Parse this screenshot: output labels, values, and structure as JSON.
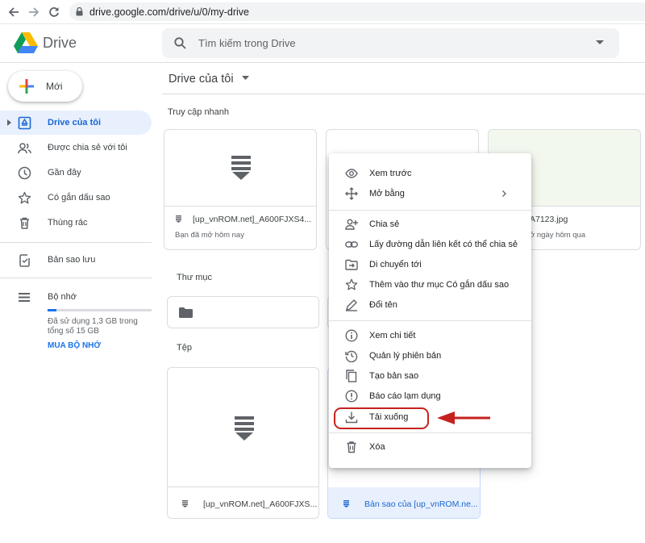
{
  "browser": {
    "url": "drive.google.com/drive/u/0/my-drive"
  },
  "header": {
    "app_name": "Drive",
    "search_placeholder": "Tìm kiếm trong Drive"
  },
  "sidebar": {
    "new_label": "Mới",
    "items": [
      {
        "label": "Drive của tôi",
        "icon": "my-drive-icon"
      },
      {
        "label": "Được chia sẻ với tôi",
        "icon": "people-icon"
      },
      {
        "label": "Gần đây",
        "icon": "clock-icon"
      },
      {
        "label": "Có gắn dấu sao",
        "icon": "star-icon"
      },
      {
        "label": "Thùng rác",
        "icon": "trash-icon"
      },
      {
        "label": "Bản sao lưu",
        "icon": "backup-icon"
      },
      {
        "label": "Bộ nhớ",
        "icon": "storage-icon"
      }
    ],
    "storage_text": "Đã sử dụng 1,3 GB trong tổng số 15 GB",
    "storage_used_fraction": 0.087,
    "buy_storage": "MUA BỘ NHỚ"
  },
  "main": {
    "breadcrumb": "Drive của tôi",
    "quick_access_label": "Truy cập nhanh",
    "quick_access": [
      {
        "name": "[up_vnROM.net]_A600FJXS4...",
        "sub": "Bạn đã mở hôm nay"
      },
      {
        "name": "A7123.jpg",
        "sub": "ở ngày hôm qua"
      }
    ],
    "folders_label": "Thư mục",
    "files_label": "Tệp",
    "files": [
      {
        "name": "[up_vnROM.net]_A600FJXS..."
      },
      {
        "name": "Bản sao của [up_vnROM.ne..."
      }
    ]
  },
  "context_menu": {
    "items": [
      {
        "label": "Xem trước",
        "icon": "eye-icon"
      },
      {
        "label": "Mở bằng",
        "icon": "move-arrows-icon"
      },
      {
        "label": "Chia sẻ",
        "icon": "person-add-icon"
      },
      {
        "label": "Lấy đường dẫn liên kết có thể chia sẻ",
        "icon": "link-icon"
      },
      {
        "label": "Di chuyển tới",
        "icon": "folder-move-icon"
      },
      {
        "label": "Thêm vào thư mục Có gắn dấu sao",
        "icon": "star-icon"
      },
      {
        "label": "Đổi tên",
        "icon": "pencil-icon"
      },
      {
        "label": "Xem chi tiết",
        "icon": "info-icon"
      },
      {
        "label": "Quản lý phiên bản",
        "icon": "history-icon"
      },
      {
        "label": "Tạo bản sao",
        "icon": "copy-icon"
      },
      {
        "label": "Báo cáo lạm dụng",
        "icon": "report-icon"
      },
      {
        "label": "Tải xuống",
        "icon": "download-icon"
      },
      {
        "label": "Xóa",
        "icon": "trash-icon"
      }
    ]
  },
  "colors": {
    "accent": "#1967d2",
    "highlight": "#c5221f"
  }
}
